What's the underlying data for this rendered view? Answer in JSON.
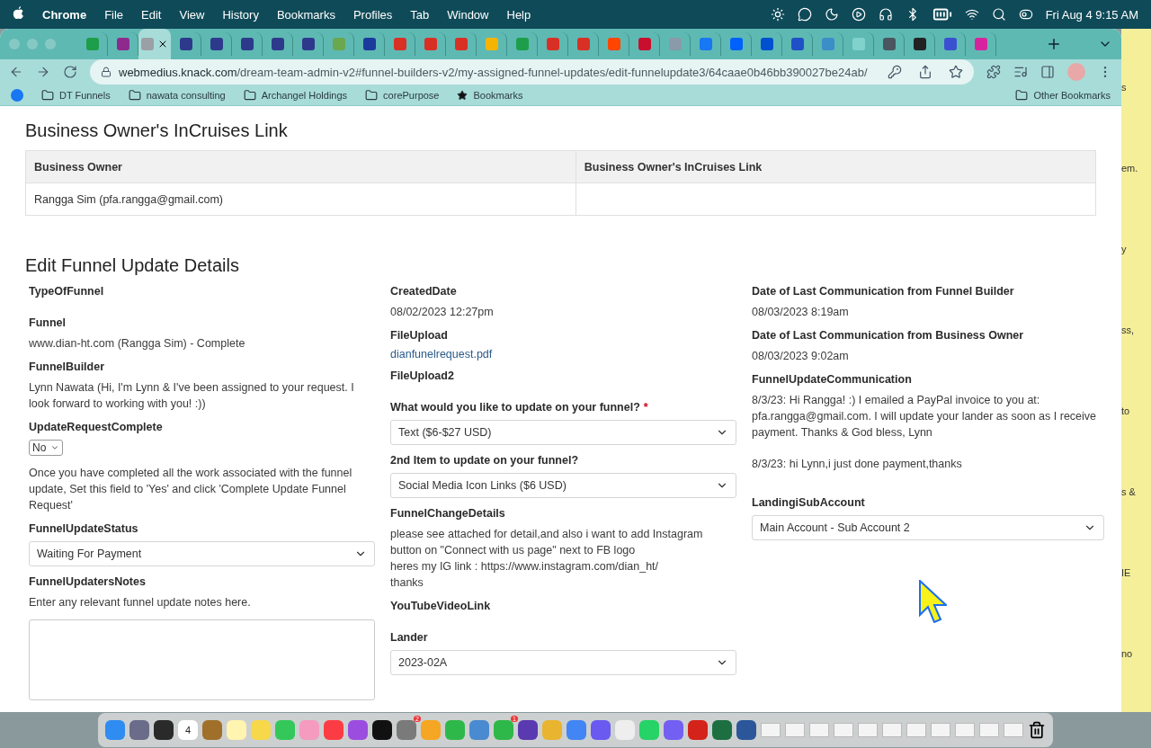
{
  "menubar": {
    "app": "Chrome",
    "menus": [
      "File",
      "Edit",
      "View",
      "History",
      "Bookmarks",
      "Profiles",
      "Tab",
      "Window",
      "Help"
    ],
    "clock": "Fri Aug 4  9:15 AM"
  },
  "tabs": [
    {
      "color": "#1e9e4a",
      "selected": false
    },
    {
      "color": "#8e2a8e",
      "selected": false
    },
    {
      "color": "#9aa0a6",
      "selected": true
    },
    {
      "color": "#2d3a8c",
      "selected": false
    },
    {
      "color": "#2d3a8c",
      "selected": false
    },
    {
      "color": "#2d3a8c",
      "selected": false
    },
    {
      "color": "#2d3a8c",
      "selected": false
    },
    {
      "color": "#2d3a8c",
      "selected": false
    },
    {
      "color": "#6aa84f",
      "selected": false
    },
    {
      "color": "#1a3a9c",
      "selected": false
    },
    {
      "color": "#d93025",
      "selected": false
    },
    {
      "color": "#d93025",
      "selected": false
    },
    {
      "color": "#d93025",
      "selected": false
    },
    {
      "color": "#f4b400",
      "selected": false
    },
    {
      "color": "#1e9e4a",
      "selected": false
    },
    {
      "color": "#d93025",
      "selected": false
    },
    {
      "color": "#d93025",
      "selected": false
    },
    {
      "color": "#ff4500",
      "selected": false
    },
    {
      "color": "#c8102e",
      "selected": false
    },
    {
      "color": "#8a9aa8",
      "selected": false
    },
    {
      "color": "#1877f2",
      "selected": false
    },
    {
      "color": "#0061fe",
      "selected": false
    },
    {
      "color": "#0050d0",
      "selected": false
    },
    {
      "color": "#1f50c8",
      "selected": false
    },
    {
      "color": "#3b8ec8",
      "selected": false
    },
    {
      "color": "#7fd3cc",
      "selected": false
    },
    {
      "color": "#4a5560",
      "selected": false
    },
    {
      "color": "#222222",
      "selected": false
    },
    {
      "color": "#3a50d0",
      "selected": false
    },
    {
      "color": "#d6249f",
      "selected": false
    }
  ],
  "address": {
    "host": "webmedius.knack.com",
    "path": "/dream-team-admin-v2#funnel-builders-v2/my-assigned-funnel-updates/edit-funnelupdate3/64caae0b46bb390027be24ab/"
  },
  "bookmarks": {
    "items": [
      {
        "kind": "facebook"
      },
      {
        "kind": "folder",
        "label": "DT Funnels"
      },
      {
        "kind": "folder",
        "label": "nawata consulting"
      },
      {
        "kind": "folder",
        "label": "Archangel Holdings"
      },
      {
        "kind": "folder",
        "label": "corePurpose"
      },
      {
        "kind": "star",
        "label": "Bookmarks"
      }
    ],
    "other": "Other Bookmarks"
  },
  "link_section": {
    "title": "Business Owner's InCruises Link",
    "table": {
      "columns": [
        "Business Owner",
        "Business Owner's InCruises Link"
      ],
      "rows": [
        [
          "Rangga Sim (pfa.rangga@gmail.com)",
          ""
        ]
      ]
    }
  },
  "details": {
    "title": "Edit Funnel Update Details",
    "columns": [
      [
        {
          "label": "TypeOfFunnel",
          "kind": "empty"
        },
        {
          "label": "Funnel",
          "kind": "text",
          "lines": [
            "www.dian-ht.com (Rangga Sim) - Complete"
          ]
        },
        {
          "label": "FunnelBuilder",
          "kind": "text",
          "lines": [
            "Lynn Nawata (Hi, I'm Lynn & I've been assigned to your request. I look forward to working with you! :))"
          ]
        },
        {
          "label": "UpdateRequestComplete",
          "kind": "small-select",
          "value": "No",
          "note_below": "Once you have completed all the work associated with the funnel update, Set this field to 'Yes' and click 'Complete Update Funnel Request'"
        },
        {
          "label": "FunnelUpdateStatus",
          "kind": "select",
          "value": "Waiting For Payment"
        },
        {
          "label": "FunnelUpdatersNotes",
          "kind": "textarea",
          "note_above": "Enter any relevant funnel update notes here."
        }
      ],
      [
        {
          "label": "CreatedDate",
          "kind": "text",
          "lines": [
            "08/02/2023 12:27pm"
          ]
        },
        {
          "label": "FileUpload",
          "kind": "link",
          "value": "dianfunelrequest.pdf"
        },
        {
          "label": "FileUpload2",
          "kind": "empty"
        },
        {
          "label": "What would you like to update on your funnel?",
          "required": true,
          "required_mark": "*",
          "kind": "select",
          "value": "Text ($6-$27 USD)"
        },
        {
          "label": "2nd Item to update on your funnel?",
          "kind": "select",
          "value": "Social Media Icon Links ($6 USD)"
        },
        {
          "label": "FunnelChangeDetails",
          "kind": "text",
          "lines": [
            "please see attached for detail,and also i want to add Instagram button on \"Connect with us page\" next to FB logo",
            "heres my IG link : https://www.instagram.com/dian_ht/",
            "thanks"
          ]
        },
        {
          "label": "YouTubeVideoLink",
          "kind": "empty"
        },
        {
          "label": "Lander",
          "kind": "select",
          "value": "2023-02A"
        }
      ],
      [
        {
          "label": "Date of Last Communication from Funnel Builder",
          "kind": "text",
          "lines": [
            "08/03/2023 8:19am"
          ]
        },
        {
          "label": "Date of Last Communication from Business Owner",
          "kind": "text",
          "lines": [
            "08/03/2023 9:02am"
          ]
        },
        {
          "label": "FunnelUpdateCommunication",
          "kind": "paragraphs",
          "lines": [
            "8/3/23: Hi Rangga! :) I emailed a PayPal invoice to you at: pfa.rangga@gmail.com. I will update your lander as soon as I receive payment. Thanks & God bless, Lynn",
            "8/3/23: hi Lynn,i just done payment,thanks"
          ]
        },
        {
          "label": "LandingiSubAccount",
          "kind": "select",
          "value": "Main Account - Sub Account 2"
        }
      ]
    ]
  },
  "side_note": {
    "fragments": [
      "s",
      "em.",
      "y",
      "ss,",
      "to",
      "s &",
      "IE",
      "no"
    ]
  },
  "dock": {
    "apps": [
      {
        "color": "#2f8cf0"
      },
      {
        "color": "#6b6b8a"
      },
      {
        "color": "#2a2a2a"
      },
      {
        "color": "#ffffff",
        "text": "4"
      },
      {
        "color": "#a0702a"
      },
      {
        "color": "#fff4b0"
      },
      {
        "color": "#f6d84a"
      },
      {
        "color": "#34c759"
      },
      {
        "color": "#f49bbf"
      },
      {
        "color": "#fc3c44"
      },
      {
        "color": "#9b4de0"
      },
      {
        "color": "#111111"
      },
      {
        "color": "#7a7a7a",
        "badge": "2"
      },
      {
        "color": "#f5a623"
      },
      {
        "color": "#2fb84a"
      },
      {
        "color": "#4a8ad0"
      },
      {
        "color": "#2fb84a",
        "badge": "1"
      },
      {
        "color": "#5a3ab0"
      },
      {
        "color": "#e9b430"
      },
      {
        "color": "#4285f4"
      },
      {
        "color": "#6a5af0"
      },
      {
        "color": "#eeeeee"
      },
      {
        "color": "#25d366"
      },
      {
        "color": "#7360f2"
      },
      {
        "color": "#d4231b"
      },
      {
        "color": "#1d6f42"
      },
      {
        "color": "#2b579a"
      }
    ]
  }
}
